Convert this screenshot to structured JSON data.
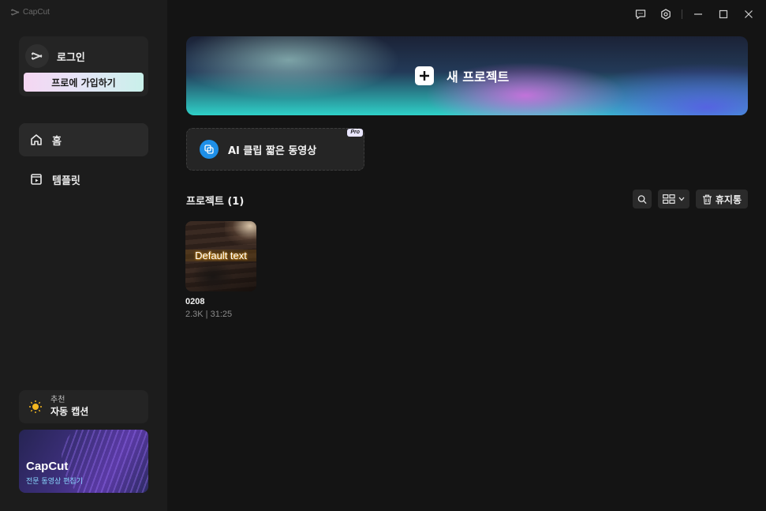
{
  "app": {
    "logo_text": "CapCut"
  },
  "sidebar": {
    "login_label": "로그인",
    "pro_signup_label": "프로에 가입하기",
    "nav": [
      {
        "label": "홈",
        "icon": "home-icon",
        "active": true
      },
      {
        "label": "템플릿",
        "icon": "template-icon",
        "active": false
      }
    ],
    "recommend": {
      "small": "추천",
      "title": "자동 캡션",
      "icon": "lightbulb-icon"
    },
    "promo": {
      "title": "CapCut",
      "subtitle": "전문 동영상 편집기"
    }
  },
  "titlebar": {
    "icons": [
      "feedback-icon",
      "settings-icon",
      "minimize-icon",
      "maximize-icon",
      "close-icon"
    ]
  },
  "main": {
    "new_project_label": "새 프로젝트",
    "ai_clip_label": "AI 클립 짧은 동영상",
    "pro_badge": "Pro",
    "projects_title": "프로젝트 (1)",
    "trash_label": "휴지통",
    "projects": [
      {
        "name": "0208",
        "meta": "2.3K | 31:25",
        "thumb_text": "Default text"
      }
    ]
  },
  "colors": {
    "background": "#141414",
    "sidebar": "#1c1c1c",
    "card": "#242424",
    "ai_icon": "#1e8fe8"
  }
}
